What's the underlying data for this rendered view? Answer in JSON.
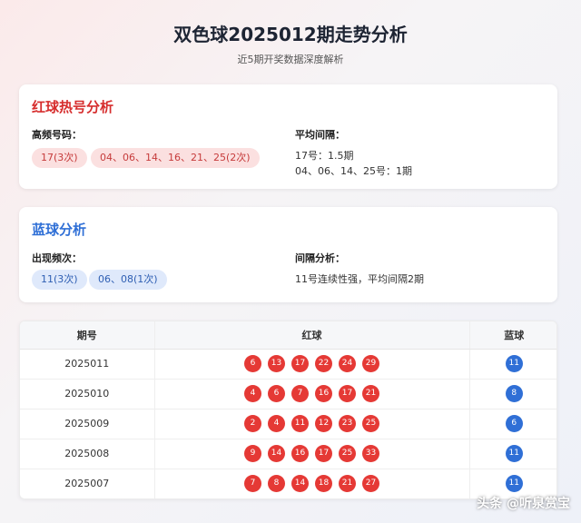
{
  "title": "双色球2025012期走势分析",
  "subtitle": "近5期开奖数据深度解析",
  "red_card": {
    "heading": "红球热号分析",
    "freq_label": "高频号码：",
    "pills": [
      "17(3次)",
      "04、06、14、16、21、25(2次)"
    ],
    "interval_label": "平均间隔：",
    "interval_lines": [
      "17号：1.5期",
      "04、06、14、25号：1期"
    ]
  },
  "blue_card": {
    "heading": "蓝球分析",
    "freq_label": "出现频次：",
    "pills": [
      "11(3次)",
      "06、08(1次)"
    ],
    "interval_label": "间隔分析：",
    "interval_lines": [
      "11号连续性强，平均间隔2期"
    ]
  },
  "table": {
    "headers": [
      "期号",
      "红球",
      "蓝球"
    ],
    "rows": [
      {
        "issue": "2025011",
        "red": [
          "6",
          "13",
          "17",
          "22",
          "24",
          "29"
        ],
        "blue": "11"
      },
      {
        "issue": "2025010",
        "red": [
          "4",
          "6",
          "7",
          "16",
          "17",
          "21"
        ],
        "blue": "8"
      },
      {
        "issue": "2025009",
        "red": [
          "2",
          "4",
          "11",
          "12",
          "23",
          "25"
        ],
        "blue": "6"
      },
      {
        "issue": "2025008",
        "red": [
          "9",
          "14",
          "16",
          "17",
          "25",
          "33"
        ],
        "blue": "11"
      },
      {
        "issue": "2025007",
        "red": [
          "7",
          "8",
          "14",
          "18",
          "21",
          "27"
        ],
        "blue": "11"
      }
    ]
  },
  "colors": {
    "red_ball": "#e53935",
    "blue_ball": "#2f6fd6",
    "red_heading": "#d62d2d",
    "blue_heading": "#2f6fd6"
  },
  "watermark": "头条 @听泉赏宝"
}
